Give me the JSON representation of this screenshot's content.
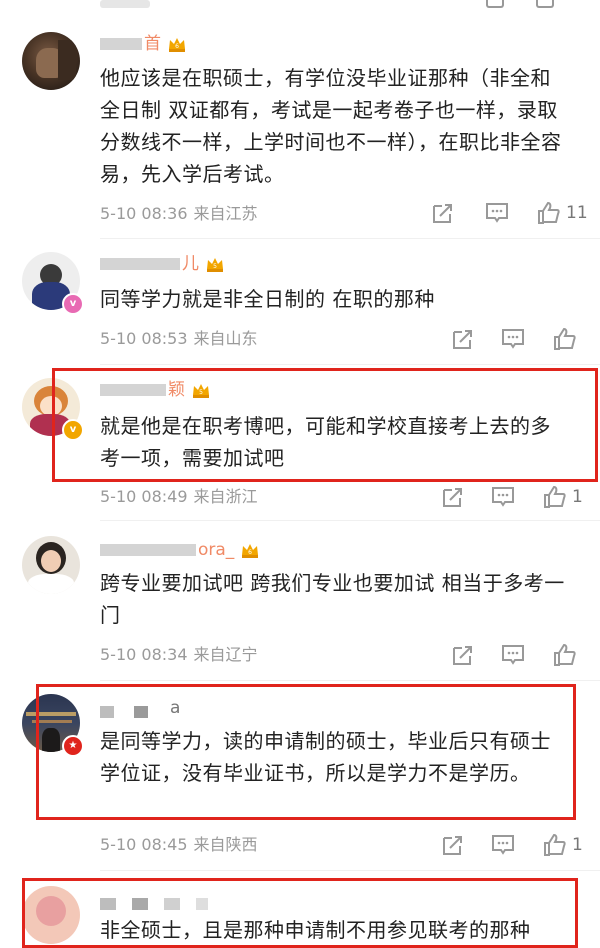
{
  "colors": {
    "accent_name": "#eb7350",
    "meta": "#9a9a9a",
    "highlight_box": "#e0241c",
    "verified_gold": "#f2a600",
    "verified_red": "#e0241c",
    "verified_pink": "#e86ab3"
  },
  "comments": [
    {
      "name_text": "首",
      "text": "他应该是在职硕士，有学位没毕业证那种（非全和全日制 双证都有，考试是一起考卷子也一样，录取分数线不一样，上学时间也不一样），在职比非全容易，先入学后考试。",
      "time": "5-10 08:36",
      "source": "来自江苏",
      "likes": "11"
    },
    {
      "name_text": "儿",
      "text": "同等学力就是非全日制的 在职的那种",
      "time": "5-10 08:53",
      "source": "来自山东",
      "likes": ""
    },
    {
      "name_text": "颖",
      "text": "就是他是在职考博吧，可能和学校直接考上去的多考一项，需要加试吧",
      "time": "5-10 08:49",
      "source": "来自浙江",
      "likes": "1"
    },
    {
      "name_text": "ora_",
      "text": "跨专业要加试吧 跨我们专业也要加试 相当于多考一门",
      "time": "5-10 08:34",
      "source": "来自辽宁",
      "likes": ""
    },
    {
      "name_text": "a",
      "text": "是同等学力，读的申请制的硕士，毕业后只有硕士学位证，没有毕业证书，所以是学力不是学历。",
      "time": "5-10 08:45",
      "source": "来自陕西",
      "likes": "1"
    },
    {
      "name_text": "",
      "text": "非全硕士，且是那种申请制不用参见联考的那种",
      "time": "",
      "source": "",
      "likes": ""
    }
  ],
  "icons": {
    "share": "share-icon",
    "comment": "comment-icon",
    "like": "like-icon",
    "level": "crown-level-icon"
  }
}
